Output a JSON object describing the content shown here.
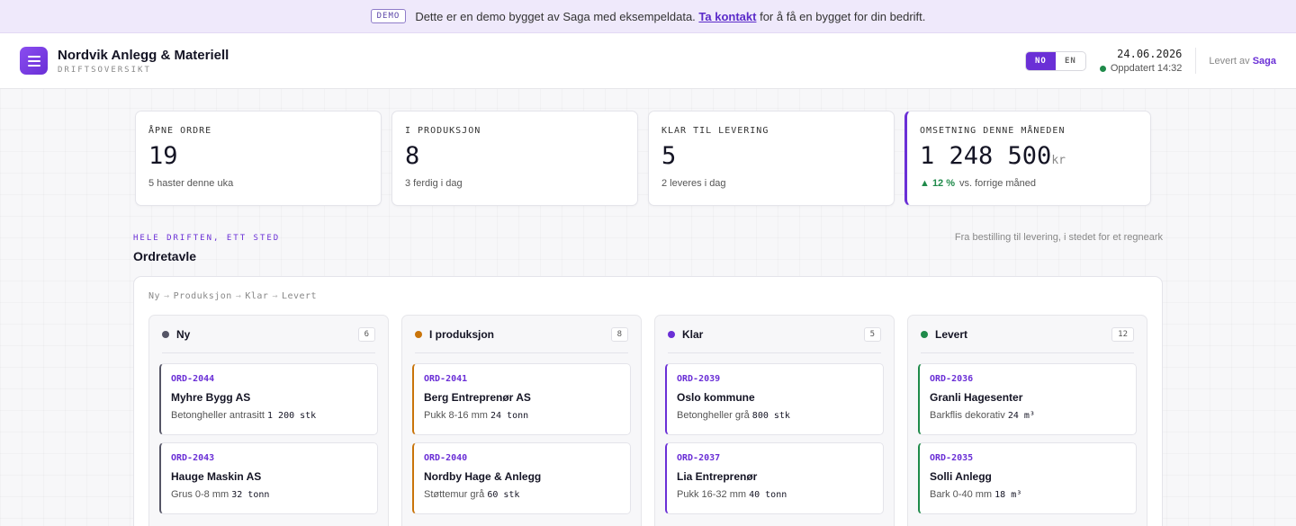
{
  "banner": {
    "badge": "DEMO",
    "text": "Dette er en demo bygget av Saga med eksempeldata.",
    "link": "Ta kontakt",
    "suffix": "for å få en bygget for din bedrift."
  },
  "header": {
    "title": "Nordvik Anlegg & Materiell",
    "subtitle": "DRIFTSOVERSIKT",
    "logo_icon": "menu-lines-icon",
    "lang_options": [
      "NO",
      "EN"
    ],
    "lang_active": "NO",
    "date": "24.06.2026",
    "updated": "Oppdatert 14:32",
    "delivered_by": "Levert av",
    "delivered_brand": "Saga"
  },
  "colors": {
    "accent": "#6a2fd6",
    "status_ny": "#555566",
    "status_produksjon": "#c9740a",
    "status_klar": "#6a2fd6",
    "status_levert": "#1f8a4a",
    "trend_up": "#1f8a4a"
  },
  "kpis": [
    {
      "label": "ÅPNE ORDRE",
      "value": "19",
      "unit": "",
      "sub": "5 haster denne uka",
      "trend": ""
    },
    {
      "label": "I PRODUKSJON",
      "value": "8",
      "unit": "",
      "sub": "3 ferdig i dag",
      "trend": ""
    },
    {
      "label": "KLAR TIL LEVERING",
      "value": "5",
      "unit": "",
      "sub": "2 leveres i dag",
      "trend": ""
    },
    {
      "label": "OMSETNING DENNE MÅNEDEN",
      "value": "1 248 500",
      "unit": "kr",
      "sub": "vs. forrige måned",
      "trend": "▲ 12 %"
    }
  ],
  "section": {
    "eyebrow": "HELE DRIFTEN, ETT STED",
    "title": "Ordretavle",
    "note": "Fra bestilling til levering, i stedet for et regneark"
  },
  "board": {
    "flow": [
      "Ny",
      "Produksjon",
      "Klar",
      "Levert"
    ],
    "flow_arrow": "→",
    "columns": [
      {
        "name": "Ny",
        "count": "6",
        "cards": [
          {
            "id": "ORD-2044",
            "customer": "Myhre Bygg AS",
            "product": "Betongheller antrasitt",
            "qty": "1 200 stk"
          },
          {
            "id": "ORD-2043",
            "customer": "Hauge Maskin AS",
            "product": "Grus 0-8 mm",
            "qty": "32 tonn"
          }
        ]
      },
      {
        "name": "I produksjon",
        "count": "8",
        "cards": [
          {
            "id": "ORD-2041",
            "customer": "Berg Entreprenør AS",
            "product": "Pukk 8-16 mm",
            "qty": "24 tonn"
          },
          {
            "id": "ORD-2040",
            "customer": "Nordby Hage & Anlegg",
            "product": "Støttemur grå",
            "qty": "60 stk"
          }
        ]
      },
      {
        "name": "Klar",
        "count": "5",
        "cards": [
          {
            "id": "ORD-2039",
            "customer": "Oslo kommune",
            "product": "Betongheller grå",
            "qty": "800 stk"
          },
          {
            "id": "ORD-2037",
            "customer": "Lia Entreprenør",
            "product": "Pukk 16-32 mm",
            "qty": "40 tonn"
          }
        ]
      },
      {
        "name": "Levert",
        "count": "12",
        "cards": [
          {
            "id": "ORD-2036",
            "customer": "Granli Hagesenter",
            "product": "Barkflis dekorativ",
            "qty": "24 m³"
          },
          {
            "id": "ORD-2035",
            "customer": "Solli Anlegg",
            "product": "Bark 0-40 mm",
            "qty": "18 m³"
          }
        ]
      }
    ]
  }
}
